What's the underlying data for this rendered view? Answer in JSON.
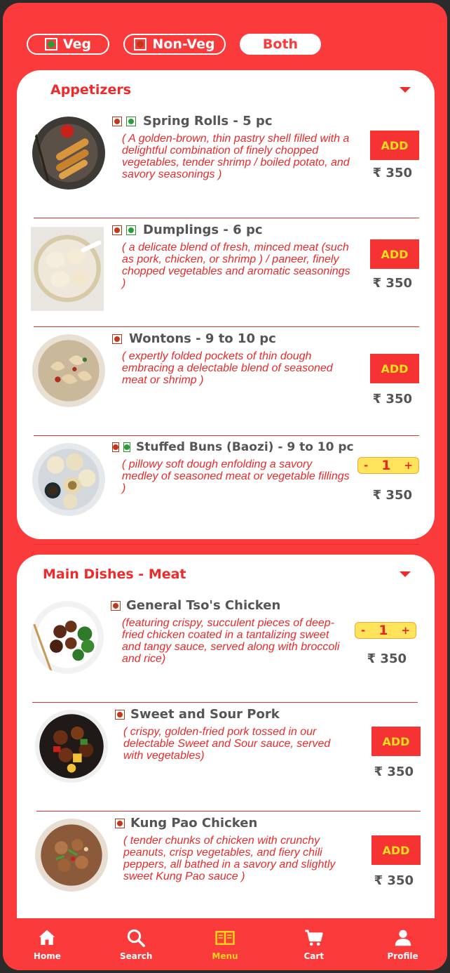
{
  "filters": {
    "veg": "Veg",
    "nonveg": "Non-Veg",
    "both": "Both",
    "selected": "Both"
  },
  "sections": [
    {
      "title": "Appetizers",
      "items": [
        {
          "name": "Spring Rolls - 5 pc",
          "desc": "( A golden-brown, thin pastry shell filled with a delightful combination of finely chopped vegetables, tender shrimp / boiled potato, and savory seasonings )",
          "price": "₹ 350",
          "action": "ADD"
        },
        {
          "name": "Dumplings - 6 pc",
          "desc": "( a delicate blend of fresh, minced meat (such as pork, chicken, or shrimp ) / paneer, finely chopped vegetables and aromatic seasonings )",
          "price": "₹ 350",
          "action": "ADD"
        },
        {
          "name": "Wontons - 9 to 10 pc",
          "desc": "( expertly folded pockets of thin dough embracing a delectable blend of seasoned meat or shrimp )",
          "price": "₹ 350",
          "action": "ADD"
        },
        {
          "name": "Stuffed Buns (Baozi) - 9 to 10 pc",
          "desc": "( pillowy soft dough enfolding a savory medley of seasoned meat or vegetable fillings )",
          "price": "₹ 350",
          "quantity": "1"
        }
      ]
    },
    {
      "title": "Main Dishes - Meat",
      "items": [
        {
          "name": "General Tso's Chicken",
          "desc": "(featuring crispy, succulent pieces of deep-fried chicken coated in a tantalizing sweet and tangy sauce, served along with broccoli and rice)",
          "price": "₹ 350",
          "quantity": "1"
        },
        {
          "name": "Sweet and Sour Pork",
          "desc": "( crispy, golden-fried pork tossed in our delectable Sweet and Sour sauce, served with vegetables)",
          "price": "₹ 350",
          "action": "ADD"
        },
        {
          "name": "Kung Pao Chicken",
          "desc": "( tender chunks of chicken with crunchy peanuts, crisp vegetables, and fiery chili peppers, all bathed in a savory and slightly sweet Kung Pao sauce )",
          "price": "₹ 350",
          "action": "ADD"
        }
      ]
    }
  ],
  "stepper": {
    "minus": "-",
    "plus": "+"
  },
  "nav": [
    {
      "label": "Home",
      "icon": "home-icon"
    },
    {
      "label": "Search",
      "icon": "search-icon"
    },
    {
      "label": "Menu",
      "icon": "menu-book-icon",
      "active": true
    },
    {
      "label": "Cart",
      "icon": "cart-icon"
    },
    {
      "label": "Profile",
      "icon": "profile-icon"
    }
  ],
  "colors": {
    "brand_red": "#fb3b3b",
    "active_nav": "#ffd41c",
    "stepper_bg": "#ffe35a"
  }
}
